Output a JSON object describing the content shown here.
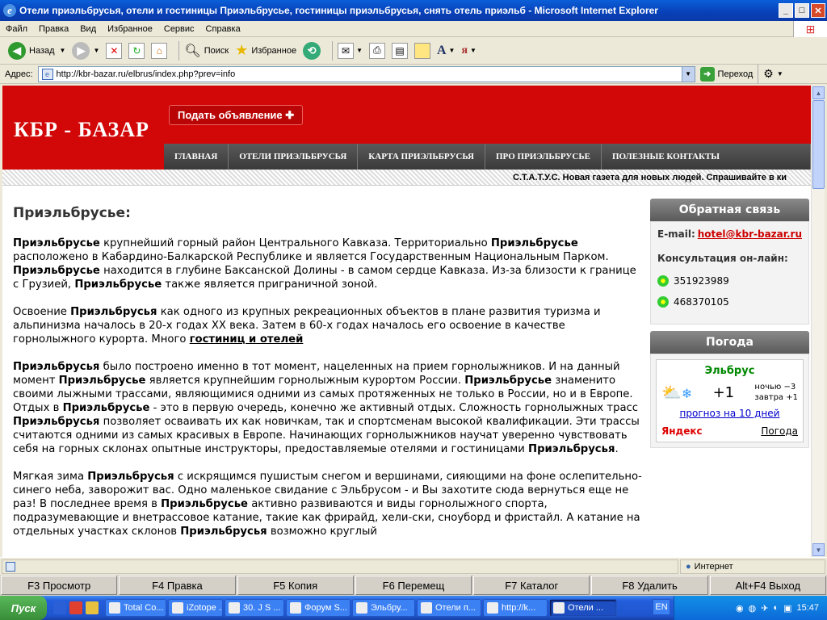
{
  "window": {
    "title": "Отели приэльбрусья, отели и гостиницы Приэльбрусье, гостиницы приэльбрусья, снять отель приэльб - Microsoft Internet Explorer"
  },
  "menu": [
    "Файл",
    "Правка",
    "Вид",
    "Избранное",
    "Сервис",
    "Справка"
  ],
  "toolbar": {
    "back": "Назад",
    "search": "Поиск",
    "favorites": "Избранное"
  },
  "address": {
    "label": "Адрес:",
    "url": "http://kbr-bazar.ru/elbrus/index.php?prev=info",
    "go": "Переход"
  },
  "site": {
    "logo": "КБР - БАЗАР",
    "submit_ad": "Подать объявление ✚",
    "nav": [
      "ГЛАВНАЯ",
      "ОТЕЛИ ПРИЭЛЬБРУСЬЯ",
      "КАРТА ПРИЭЛЬБРУСЬЯ",
      "ПРО ПРИЭЛЬБРУСЬЕ",
      "ПОЛЕЗНЫЕ КОНТАКТЫ"
    ],
    "ticker": "С.Т.А.Т.У.С. Новая газета для новых людей. Спрашивайте в ки"
  },
  "article": {
    "heading": "Приэльбрусье:",
    "p1": {
      "b1": "Приэльбрусье",
      "t1": " крупнейший горный район Центрального Кавказа. Территориально ",
      "b2": "Приэльбрусье",
      "t2": " расположено в Кабардино-Балкарской Республике и является Государственным Национальным Парком. ",
      "b3": "Приэльбрусье",
      "t3": " находится в глубине Баксанской Долины - в самом сердце Кавказа. Из-за близости к границе с Грузией, ",
      "b4": "Приэльбрусье",
      "t4": " также является приграничной зоной."
    },
    "p2": {
      "t1": "Освоение ",
      "b1": "Приэльбрусья",
      "t2": " как одного из крупных рекреационных объектов в плане развития туризма и альпинизма началось в 20-х годах XX века. Затем в 60-х годах началось его освоение в качестве горнолыжного курорта. Много ",
      "link": "гостиниц и отелей"
    },
    "p3": {
      "b1": "Приэльбрусья",
      "t1": " было построено именно в тот момент, нацеленных на прием горнолыжников. И на данный момент ",
      "b2": "Приэльбрусье",
      "t2": " является крупнейшим горнолыжным курортом России. ",
      "b3": "Приэльбрусье",
      "t3": " знаменито своими лыжными трассами, являющимися одними из самых протяженных не только в России, но и в Европе. Отдых в ",
      "b4": "Приэльбрусье",
      "t4": " - это в первую очередь, конечно же активный отдых. Сложность горнолыжных трасс ",
      "b5": "Приэльбрусья",
      "t5": " позволяет осваивать их как новичкам, так и спортсменам высокой квалификации. Эти трассы считаются одними из самых красивых в Европе. Начинающих горнолыжников научат уверенно чувствовать себя на горных склонах опытные инструкторы, предоставляемые отелями и гостиницами ",
      "b6": "Приэльбрусья",
      "t6": "."
    },
    "p4": {
      "t1": "Мягкая зима ",
      "b1": "Приэльбрусья",
      "t2": " с искрящимся пушистым снегом и вершинами, сияющими на фоне ослепительно-синего неба, заворожит вас. Одно маленькое свидание с Эльбрусом - и Вы захотите сюда вернуться еще не раз! В последнее время в ",
      "b2": "Приэльбрусье",
      "t3": " активно развиваются и виды горнолыжного спорта, подразумевающие и внетрассовое катание, такие как фрирайд, хели-ски, сноуборд и фристайл. А катание на отдельных участках склонов ",
      "b3": "Приэльбрусья",
      "t4": " возможно круглый"
    }
  },
  "sidebar": {
    "feedback_title": "Обратная связь",
    "email_label": "E-mail:",
    "email": "hotel@kbr-bazar.ru",
    "consult_label": "Консультация он-лайн:",
    "icq": [
      "351923989",
      "468370105"
    ],
    "weather_title": "Погода",
    "weather": {
      "city": "Эльбрус",
      "temp": "+1",
      "night": "ночью −3",
      "tomorrow": "завтра +1",
      "forecast_link": "прогноз на 10 дней",
      "brand": "Яндекс",
      "footer_link": "Погода"
    }
  },
  "status": {
    "zone": "Интернет"
  },
  "fkeys": [
    "F3 Просмотр",
    "F4 Правка",
    "F5 Копия",
    "F6 Перемещ",
    "F7 Каталог",
    "F8 Удалить",
    "Alt+F4 Выход"
  ],
  "taskbar": {
    "start": "Пуск",
    "tasks": [
      "Total Co...",
      "iZotope ...",
      "30. J S ...",
      "Форум S...",
      "Эльбру...",
      "Отели п...",
      "http://k...",
      "Отели ..."
    ],
    "lang": "EN",
    "clock": "15:47"
  }
}
